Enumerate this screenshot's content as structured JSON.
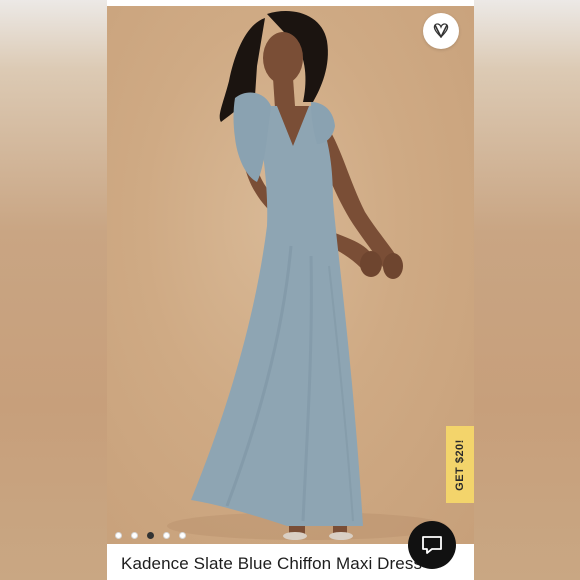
{
  "product": {
    "title": "Kadence Slate Blue Chiffon Maxi Dress"
  },
  "promo": {
    "label": "GET $20!"
  },
  "gallery": {
    "image_count": 5,
    "active_index": 2
  },
  "icons": {
    "wishlist": "heart-v-icon",
    "chat": "chat-bubble-icon"
  },
  "colors": {
    "promo_bg": "#f3d46b",
    "dress": "#8ea5b3",
    "backdrop": "#cfaa84",
    "chat_bg": "#111111"
  }
}
